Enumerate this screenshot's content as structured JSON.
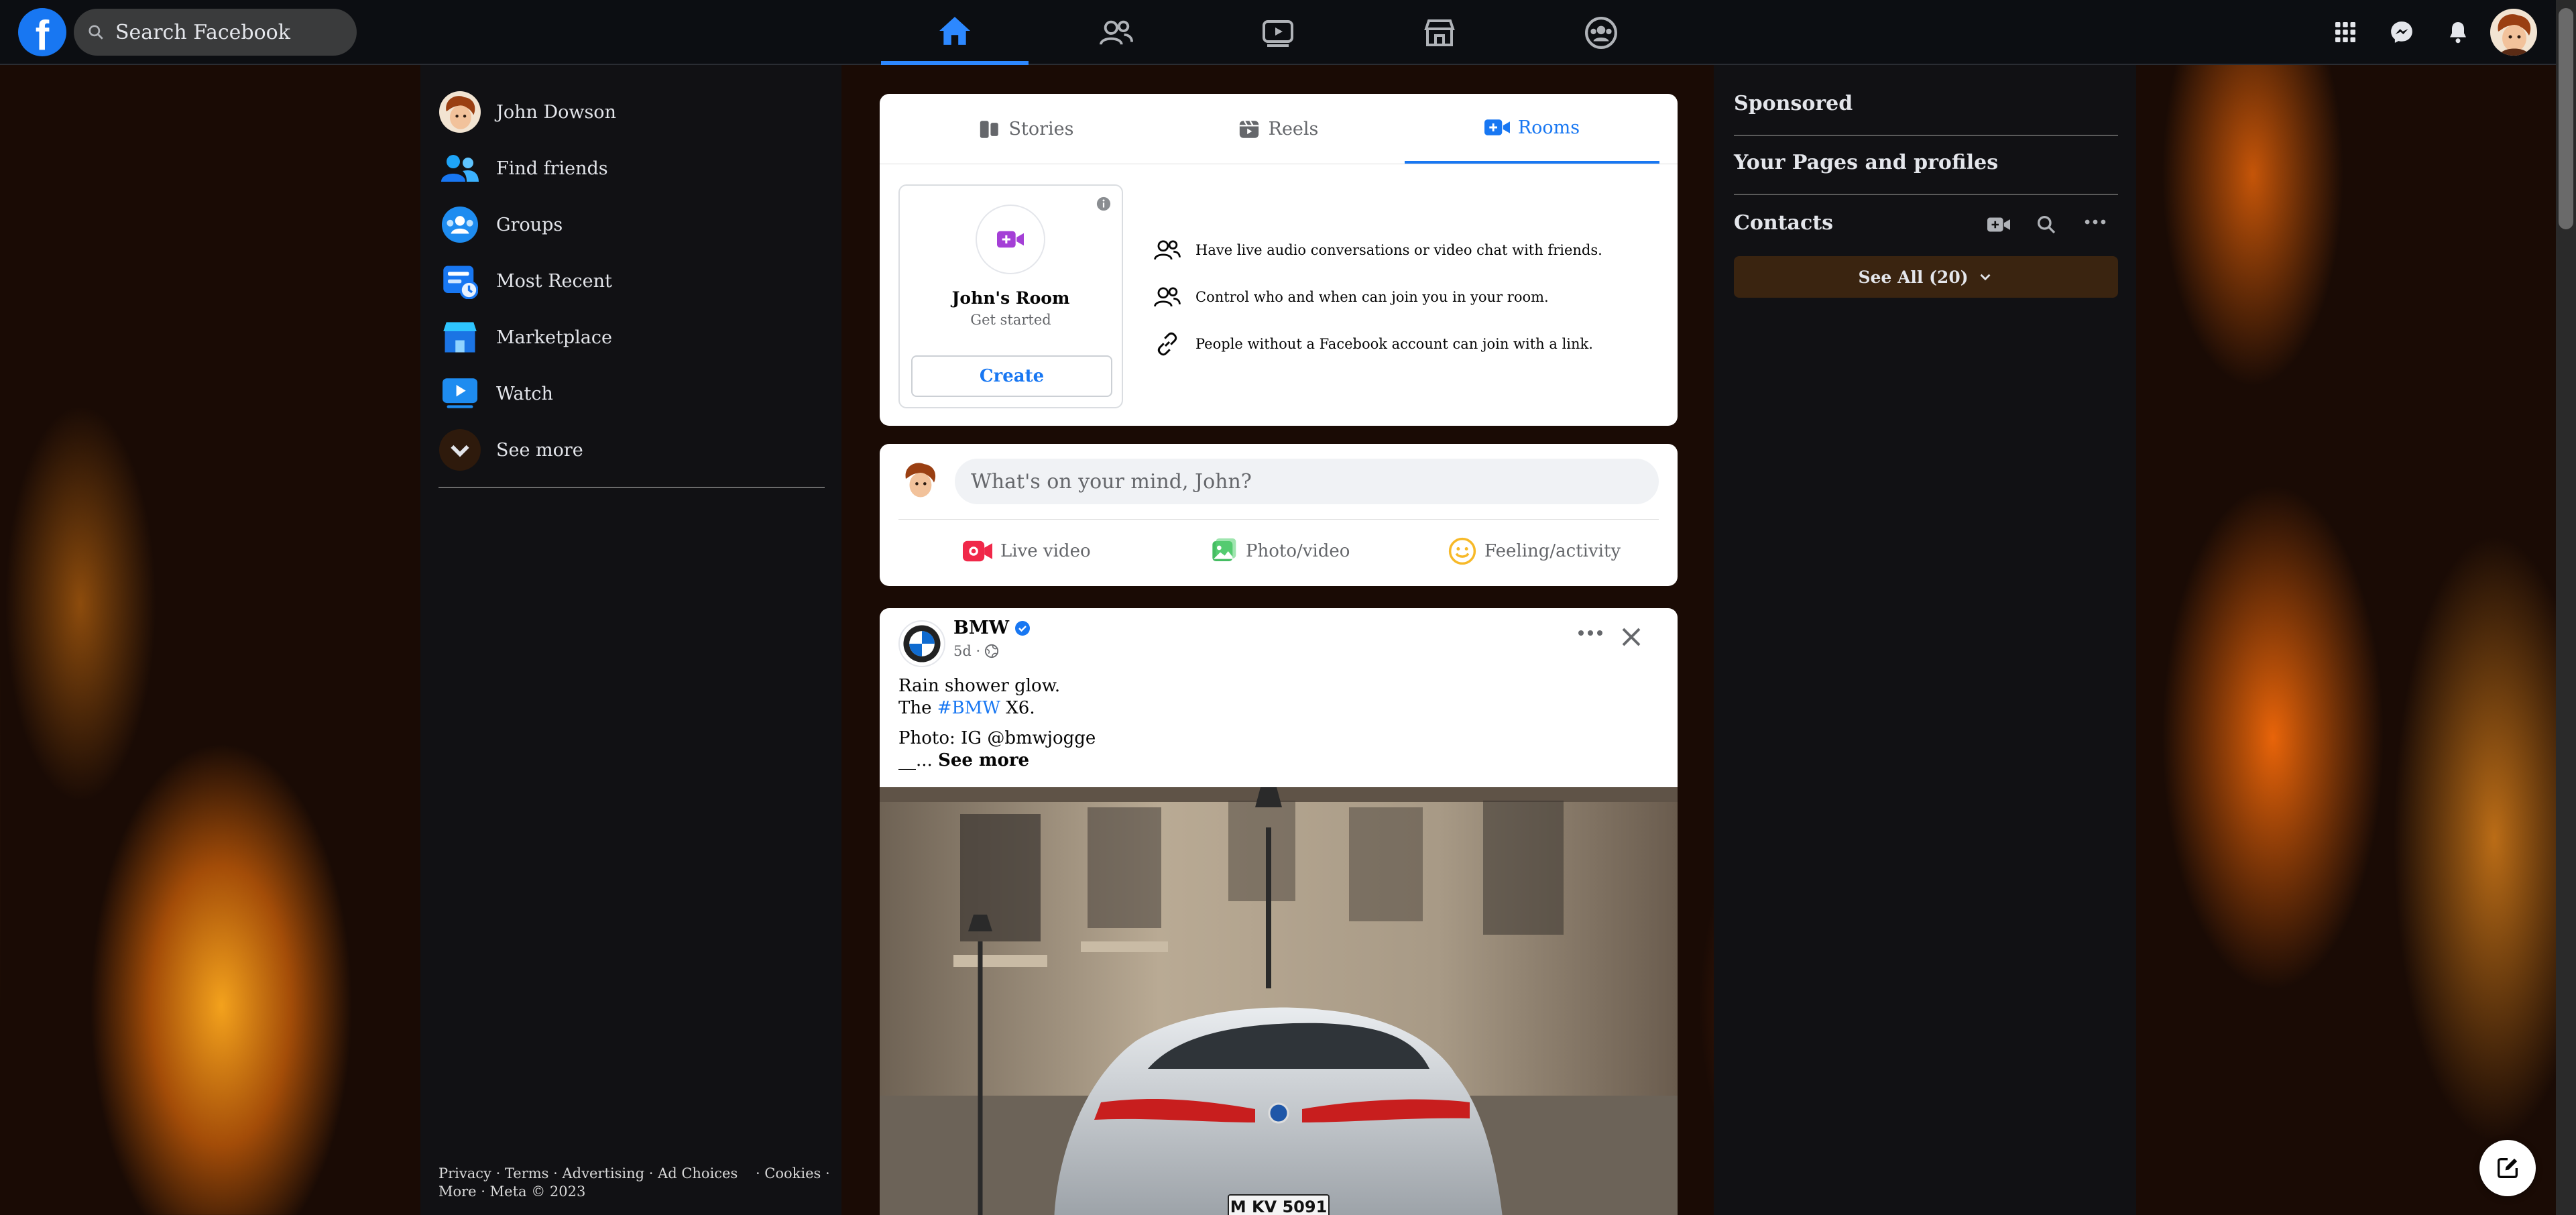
{
  "search": {
    "placeholder": "Search Facebook"
  },
  "nav_tabs": [
    "home",
    "friends",
    "watch",
    "marketplace",
    "groups"
  ],
  "left_sidebar": {
    "items": [
      {
        "label": "John Dowson",
        "icon": "avatar"
      },
      {
        "label": "Find friends",
        "icon": "friends-icon"
      },
      {
        "label": "Groups",
        "icon": "groups-icon"
      },
      {
        "label": "Most Recent",
        "icon": "feed-icon"
      },
      {
        "label": "Marketplace",
        "icon": "marketplace-icon"
      },
      {
        "label": "Watch",
        "icon": "watch-icon"
      },
      {
        "label": "See more",
        "icon": "chevron-down-icon"
      }
    ],
    "footer": {
      "line1": "Privacy · Terms · Advertising · Ad Choices    · Cookies ·",
      "line2": "More · Meta © 2023"
    }
  },
  "stories_card": {
    "tabs": [
      {
        "label": "Stories"
      },
      {
        "label": "Reels"
      },
      {
        "label": "Rooms",
        "active": true
      }
    ],
    "room": {
      "title": "John's Room",
      "subtitle": "Get started",
      "create_label": "Create"
    },
    "info": [
      "Have live audio conversations or video chat with friends.",
      "Control who and when can join you in your room.",
      "People without a Facebook account can join with a link."
    ]
  },
  "composer": {
    "placeholder": "What's on your mind, John?",
    "actions": [
      {
        "label": "Live video",
        "color": "#f02849"
      },
      {
        "label": "Photo/video",
        "color": "#45bd62"
      },
      {
        "label": "Feeling/activity",
        "color": "#f7b928"
      }
    ]
  },
  "post": {
    "author": "BMW",
    "time": "5d ·",
    "line1": "Rain shower glow.",
    "line2_prefix": "The ",
    "hashtag": "#BMW",
    "line2_suffix": " X6.",
    "line3": "Photo: IG @bmwjogge",
    "line4_prefix": "__... ",
    "see_more": "See more",
    "plate": "M KV 5091"
  },
  "right_sidebar": {
    "sponsored": "Sponsored",
    "pages": "Your Pages and profiles",
    "contacts": "Contacts",
    "see_all": "See All (20)"
  },
  "colors": {
    "brand": "#1877f2",
    "topbar": "#0c0e12",
    "panel": "#111114"
  }
}
